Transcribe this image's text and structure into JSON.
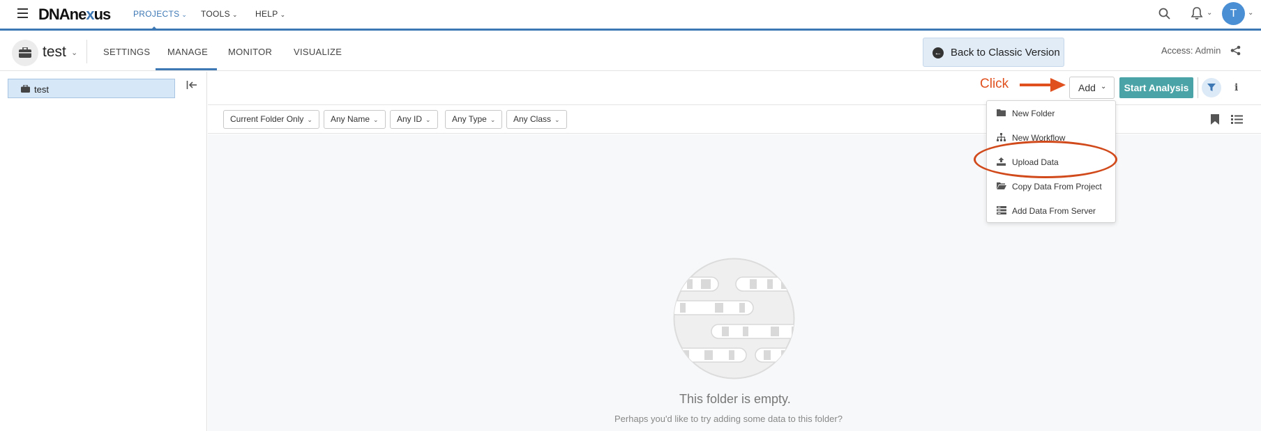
{
  "topnav": {
    "logo_main": "DNAne",
    "logo_x": "x",
    "logo_end": "us",
    "projects": "PROJECTS",
    "tools": "TOOLS",
    "help": "HELP",
    "avatar_initial": "T"
  },
  "project": {
    "name": "test",
    "tabs": [
      "SETTINGS",
      "MANAGE",
      "MONITOR",
      "VISUALIZE"
    ],
    "active_tab": "MANAGE",
    "classic_button": "Back to Classic Version",
    "access_label": "Access:",
    "access_value": "Admin"
  },
  "sidebar": {
    "root_folder": "test"
  },
  "toolbar": {
    "annotation": "Click",
    "add_label": "Add",
    "start_label": "Start Analysis",
    "brand_color": "#4aa3a6"
  },
  "filters": [
    "Current Folder Only",
    "Any Name",
    "Any ID",
    "Any Type",
    "Any Class"
  ],
  "add_menu": {
    "items": [
      {
        "label": "New Folder",
        "icon": "folder-icon"
      },
      {
        "label": "New Workflow",
        "icon": "workflow-icon"
      },
      {
        "label": "Upload Data",
        "icon": "upload-icon"
      },
      {
        "label": "Copy Data From Project",
        "icon": "folder-open-icon"
      },
      {
        "label": "Add Data From Server",
        "icon": "server-icon"
      }
    ],
    "highlighted": "Upload Data",
    "highlight_color": "#d14a1c"
  },
  "empty_state": {
    "title": "This folder is empty.",
    "subtitle": "Perhaps you'd like to try adding some data to this folder?"
  }
}
